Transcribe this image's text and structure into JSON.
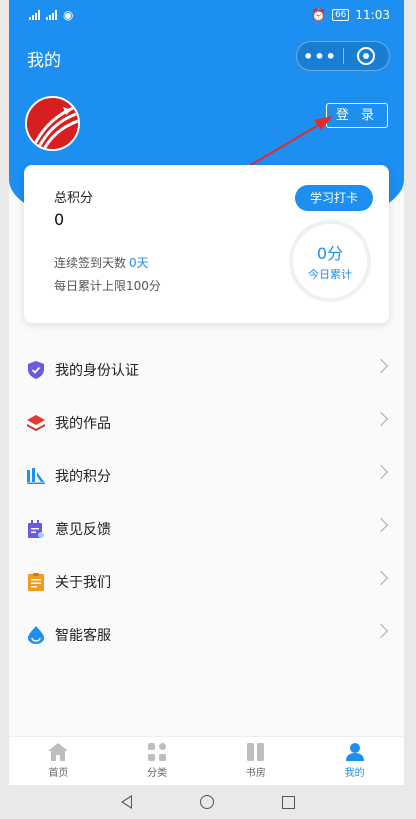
{
  "status_bar": {
    "time": "11:03",
    "battery": "66"
  },
  "header": {
    "title": "我的",
    "login_label": "登 录"
  },
  "points_card": {
    "title": "总积分",
    "total": "0",
    "checkin_label": "学习打卡",
    "streak_label": "连续签到天数",
    "streak_value": "0天",
    "limit_text": "每日累计上限100分",
    "today_value": "0分",
    "today_label": "今日累计"
  },
  "menu": [
    {
      "label": "我的身份认证",
      "icon": "shield-check-icon",
      "color": "#6a5ae0"
    },
    {
      "label": "我的作品",
      "icon": "layers-icon",
      "color": "#e23b2e"
    },
    {
      "label": "我的积分",
      "icon": "bar-chart-icon",
      "color": "#1d8ff0"
    },
    {
      "label": "意见反馈",
      "icon": "calendar-edit-icon",
      "color": "#6a5ae0"
    },
    {
      "label": "关于我们",
      "icon": "clipboard-icon",
      "color": "#f39a1a"
    },
    {
      "label": "智能客服",
      "icon": "droplet-icon",
      "color": "#1d8ff0"
    }
  ],
  "bottom_nav": [
    {
      "label": "首页",
      "icon": "home-icon"
    },
    {
      "label": "分类",
      "icon": "grid-icon"
    },
    {
      "label": "书房",
      "icon": "books-icon"
    },
    {
      "label": "我的",
      "icon": "person-icon",
      "active": true
    }
  ],
  "colors": {
    "primary": "#1d8ff0",
    "arrow": "#e22b2b"
  }
}
